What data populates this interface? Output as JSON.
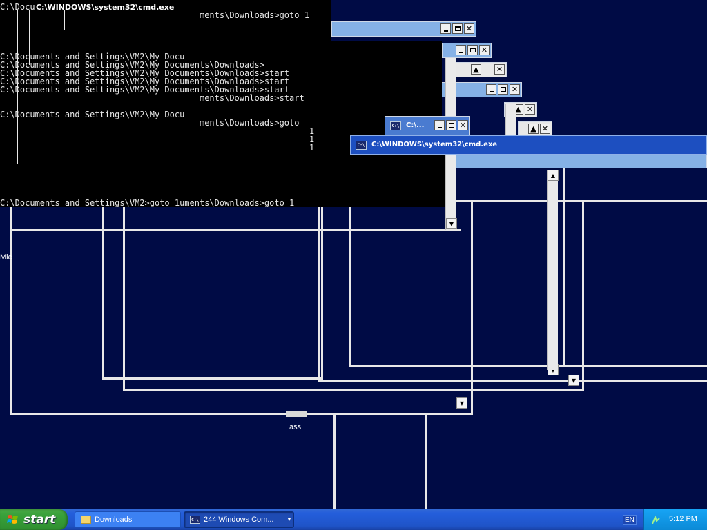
{
  "console_main": {
    "title": "C:\\WINDOWS\\system32\\cmd.exe",
    "lines": [
      "C:\\Docu",
      "                                        ments\\Downloads>goto 1",
      "",
      "",
      "",
      "",
      "C:\\Documents and Settings\\VM2\\My Docu",
      "C:\\Documents and Settings\\VM2\\My Documents\\Downloads>",
      "C:\\Documents and Settings\\VM2\\My Documents\\Downloads>start",
      "C:\\Documents and Settings\\VM2\\My Documents\\Downloads>start",
      "C:\\Documents and Settings\\VM2\\My Documents\\Downloads>start",
      "                                        ments\\Downloads>start",
      "",
      "C:\\Documents and Settings\\VM2\\My Docu",
      "                                        ments\\Downloads>goto",
      "                                                              1",
      "                                                              1",
      "                                                              1"
    ],
    "last_line": "C:\\Documents and Settings\\VM2>goto 1uments\\Downloads>goto 1"
  },
  "small_console": {
    "title": "C:\\..."
  },
  "front_console": {
    "title": "C:\\WINDOWS\\system32\\cmd.exe"
  },
  "desktop": {
    "icon_label": "ass",
    "side_label": "Mic"
  },
  "taskbar": {
    "start_label": "start",
    "downloads_label": "Downloads",
    "group_label": "244 Windows Com...",
    "lang": "EN",
    "clock": "5:12 PM"
  },
  "colors": {
    "desktop": "#000b45",
    "taskbar": "#245edb",
    "start": "#38a03a",
    "title_active": "#3e6fc8",
    "title_inactive": "#85b1e6"
  }
}
